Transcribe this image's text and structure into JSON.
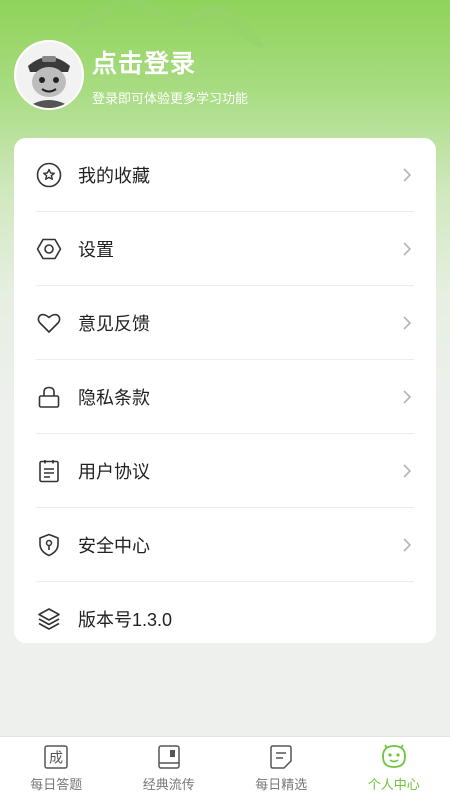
{
  "header": {
    "title": "点击登录",
    "subtitle": "登录即可体验更多学习功能",
    "avatar_icon": "cartoon-avatar-icon"
  },
  "menu": {
    "items": [
      {
        "label": "我的收藏",
        "icon": "star-circle-icon",
        "has_arrow": true
      },
      {
        "label": "设置",
        "icon": "hexagon-settings-icon",
        "has_arrow": true
      },
      {
        "label": "意见反馈",
        "icon": "heart-icon",
        "has_arrow": true
      },
      {
        "label": "隐私条款",
        "icon": "lock-icon",
        "has_arrow": true
      },
      {
        "label": "用户协议",
        "icon": "clipboard-icon",
        "has_arrow": true
      },
      {
        "label": "安全中心",
        "icon": "shield-icon",
        "has_arrow": true
      },
      {
        "label": "版本号1.3.0",
        "icon": "layers-icon",
        "has_arrow": false
      }
    ]
  },
  "tabbar": {
    "items": [
      {
        "label": "每日答题",
        "icon": "idiom-char-icon",
        "glyph": "成",
        "active": false
      },
      {
        "label": "经典流传",
        "icon": "book-icon",
        "active": false
      },
      {
        "label": "每日精选",
        "icon": "note-icon",
        "active": false
      },
      {
        "label": "个人中心",
        "icon": "smiley-bubble-icon",
        "active": true
      }
    ]
  },
  "colors": {
    "accent": "#6cc63a",
    "header_green": "#8fd35a",
    "text": "#222222",
    "tab_inactive": "#777777"
  }
}
